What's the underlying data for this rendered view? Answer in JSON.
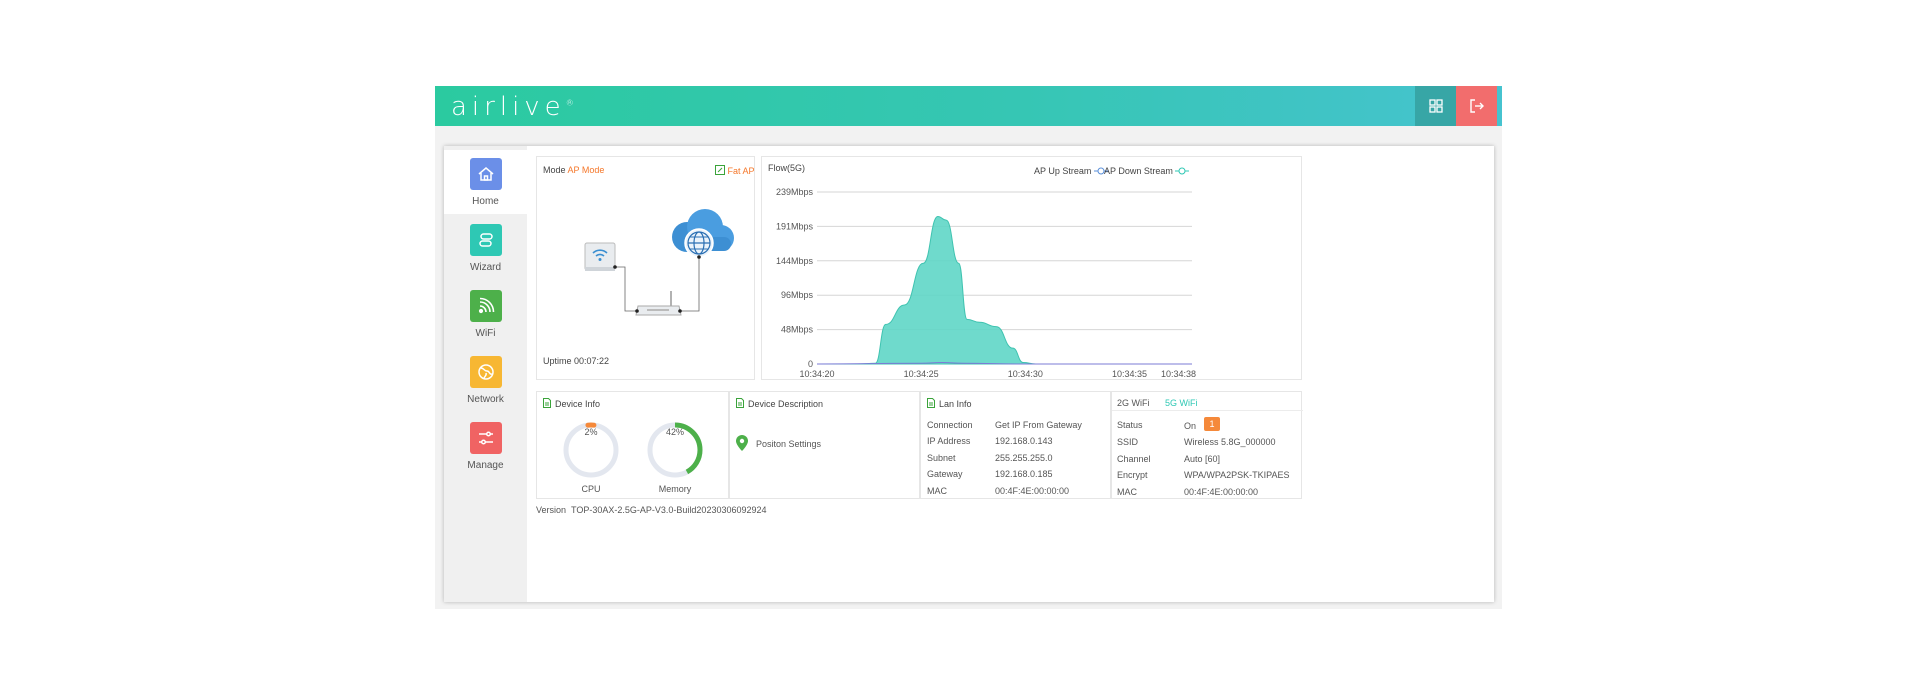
{
  "header": {
    "logo": "airlive",
    "logo_mark": "®"
  },
  "sidebar": {
    "items": [
      {
        "label": "Home",
        "icon": "home-icon",
        "color": "#6b8fe8"
      },
      {
        "label": "Wizard",
        "icon": "wizard-icon",
        "color": "#2ec8b4"
      },
      {
        "label": "WiFi",
        "icon": "wifi-icon",
        "color": "#4db04a"
      },
      {
        "label": "Network",
        "icon": "globe-icon",
        "color": "#f7b733"
      },
      {
        "label": "Manage",
        "icon": "sliders-icon",
        "color": "#f06363"
      }
    ]
  },
  "mode": {
    "label": "Mode",
    "value": "AP Mode",
    "fat_ap": "Fat AP",
    "uptime_label": "Uptime",
    "uptime": "00:07:22"
  },
  "flow": {
    "title": "Flow(5G)",
    "legend_up": "AP Up Stream",
    "legend_down": "AP Down Stream"
  },
  "chart_data": {
    "type": "area",
    "title": "Flow(5G)",
    "x": [
      "10:34:20",
      "10:34:25",
      "10:34:30",
      "10:34:35",
      "10:34:38"
    ],
    "y_ticks": [
      "0",
      "48Mbps",
      "96Mbps",
      "144Mbps",
      "191Mbps",
      "239Mbps"
    ],
    "ylim": [
      0,
      239
    ],
    "grid": true,
    "legend_position": "top-right",
    "series": [
      {
        "name": "AP Up Stream",
        "color": "#5fd6c6",
        "points": [
          [
            0,
            0
          ],
          [
            2,
            0
          ],
          [
            2.8,
            1
          ],
          [
            3.3,
            55
          ],
          [
            4.2,
            82
          ],
          [
            5.1,
            140
          ],
          [
            5.8,
            205
          ],
          [
            6.2,
            200
          ],
          [
            6.8,
            140
          ],
          [
            7.2,
            62
          ],
          [
            7.8,
            58
          ],
          [
            8.6,
            52
          ],
          [
            9.4,
            22
          ],
          [
            9.9,
            2
          ],
          [
            10.5,
            0
          ],
          [
            16,
            0
          ],
          [
            18,
            0
          ]
        ]
      },
      {
        "name": "AP Down Stream",
        "color": "#7b7bd6",
        "points": [
          [
            0,
            0
          ],
          [
            5,
            1
          ],
          [
            6,
            2
          ],
          [
            7,
            1
          ],
          [
            10,
            0
          ],
          [
            18,
            0
          ]
        ]
      }
    ]
  },
  "device_info": {
    "title": "Device Info",
    "cpu_label": "CPU",
    "cpu_text": "2%",
    "cpu_value": 2,
    "mem_label": "Memory",
    "mem_text": "42%",
    "mem_value": 42
  },
  "device_description": {
    "title": "Device Description",
    "position": "Positon Settings"
  },
  "lan_info": {
    "title": "Lan Info",
    "rows": [
      {
        "k": "Connection",
        "v": "Get IP From Gateway"
      },
      {
        "k": "IP Address",
        "v": "192.168.0.143"
      },
      {
        "k": "Subnet",
        "v": "255.255.255.0"
      },
      {
        "k": "Gateway",
        "v": "192.168.0.185"
      },
      {
        "k": "MAC",
        "v": "00:4F:4E:00:00:00"
      }
    ]
  },
  "wifi_info": {
    "tab_2g": "2G WiFi",
    "tab_5g": "5G WiFi",
    "status_label": "Status",
    "status": "On",
    "badge": "1",
    "rows": [
      {
        "k": "SSID",
        "v": "Wireless 5.8G_000000"
      },
      {
        "k": "Channel",
        "v": "Auto [60]"
      },
      {
        "k": "Encrypt",
        "v": "WPA/WPA2PSK-TKIPAES"
      },
      {
        "k": "MAC",
        "v": "00:4F:4E:00:00:00"
      }
    ]
  },
  "footer": {
    "version_label": "Version",
    "version": "TOP-30AX-2.5G-AP-V3.0-Build20230306092924"
  }
}
